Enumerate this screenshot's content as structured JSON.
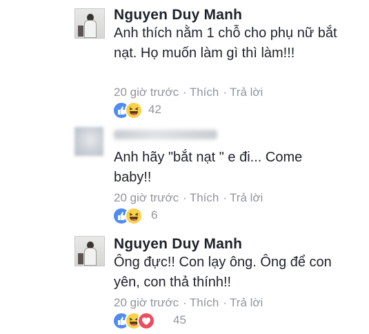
{
  "comments": [
    {
      "author": "Nguyen Duy Manh",
      "text": "Anh thích nằm 1 chỗ cho phụ nữ bắt nạt. Họ muốn làm gì thì làm!!!",
      "time": "20 giờ trước",
      "like_label": "Thích",
      "reply_label": "Trả lời",
      "reactions": [
        "like-icon",
        "haha-icon"
      ],
      "reaction_count": "42"
    },
    {
      "author": "",
      "text": "Anh hãy \"bắt nạt \" e đi...  Come baby!!",
      "time": "20 giờ trước",
      "like_label": "Thích",
      "reply_label": "Trả lời",
      "reactions": [
        "like-icon",
        "haha-icon"
      ],
      "reaction_count": "6"
    },
    {
      "author": "Nguyen Duy Manh",
      "text": "Ông đực!! Con lạy ông. Ông để con yên, con thả thính!!",
      "time": "20 giờ trước",
      "like_label": "Thích",
      "reply_label": "Trả lời",
      "reactions": [
        "like-icon",
        "haha-icon",
        "love-icon"
      ],
      "reaction_count": "45"
    }
  ],
  "separator": "·",
  "colors": {
    "text": "#1d2129",
    "meta": "#90949c",
    "like": "#4e8cf0",
    "haha": "#f7d14c",
    "love": "#ef4b5e"
  }
}
